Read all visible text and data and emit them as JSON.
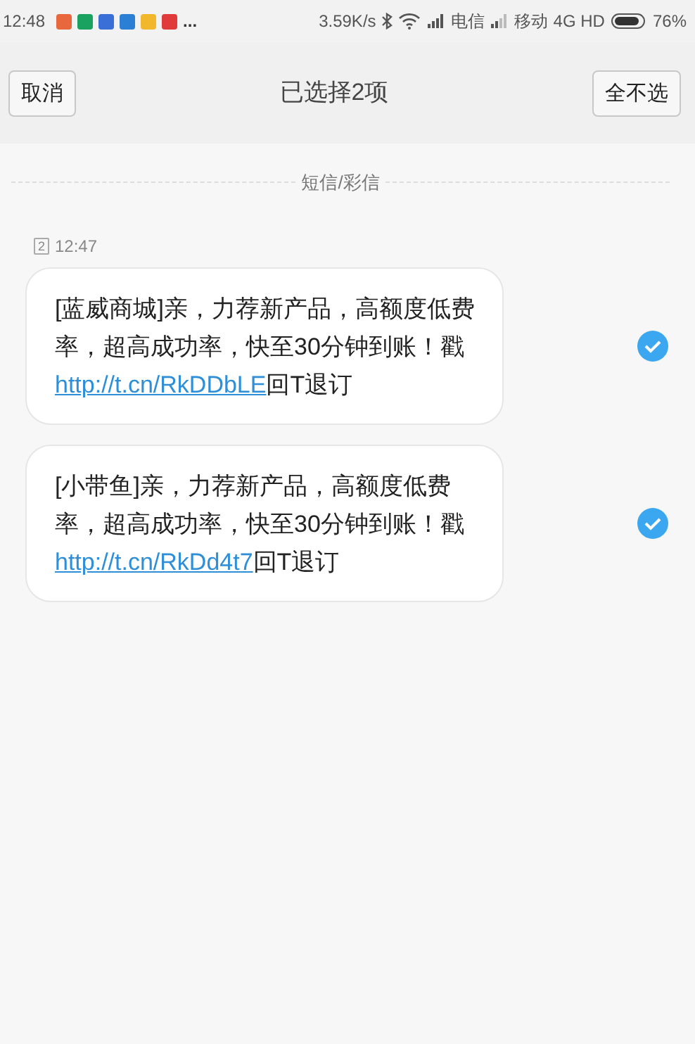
{
  "status_bar": {
    "time": "12:48",
    "notification_icons": [
      {
        "color": "#e8673c"
      },
      {
        "color": "#1aa260"
      },
      {
        "color": "#3a6fd8"
      },
      {
        "color": "#2b7fd4"
      },
      {
        "color": "#f1b82d"
      },
      {
        "color": "#e03a3a"
      }
    ],
    "more": "...",
    "speed": "3.59K/s",
    "carrier_1": "电信",
    "carrier_2": "移动",
    "network": "4G HD",
    "battery": "76%"
  },
  "header": {
    "cancel": "取消",
    "title": "已选择2项",
    "deselect_all": "全不选"
  },
  "section_label": "短信/彩信",
  "messages": [
    {
      "sim": "2",
      "time": "12:47",
      "text": "[蓝威商城]亲，力荐新产品，高额度低费率，超高成功率，快至30分钟到账！戳",
      "link": "http://t.cn/RkDDbLE",
      "suffix": "回T退订",
      "selected": true
    },
    {
      "text": "[小带鱼]亲，力荐新产品，高额度低费率，超高成功率，快至30分钟到账！戳",
      "link": "http://t.cn/RkDd4t7",
      "suffix": "回T退订",
      "selected": true
    }
  ]
}
